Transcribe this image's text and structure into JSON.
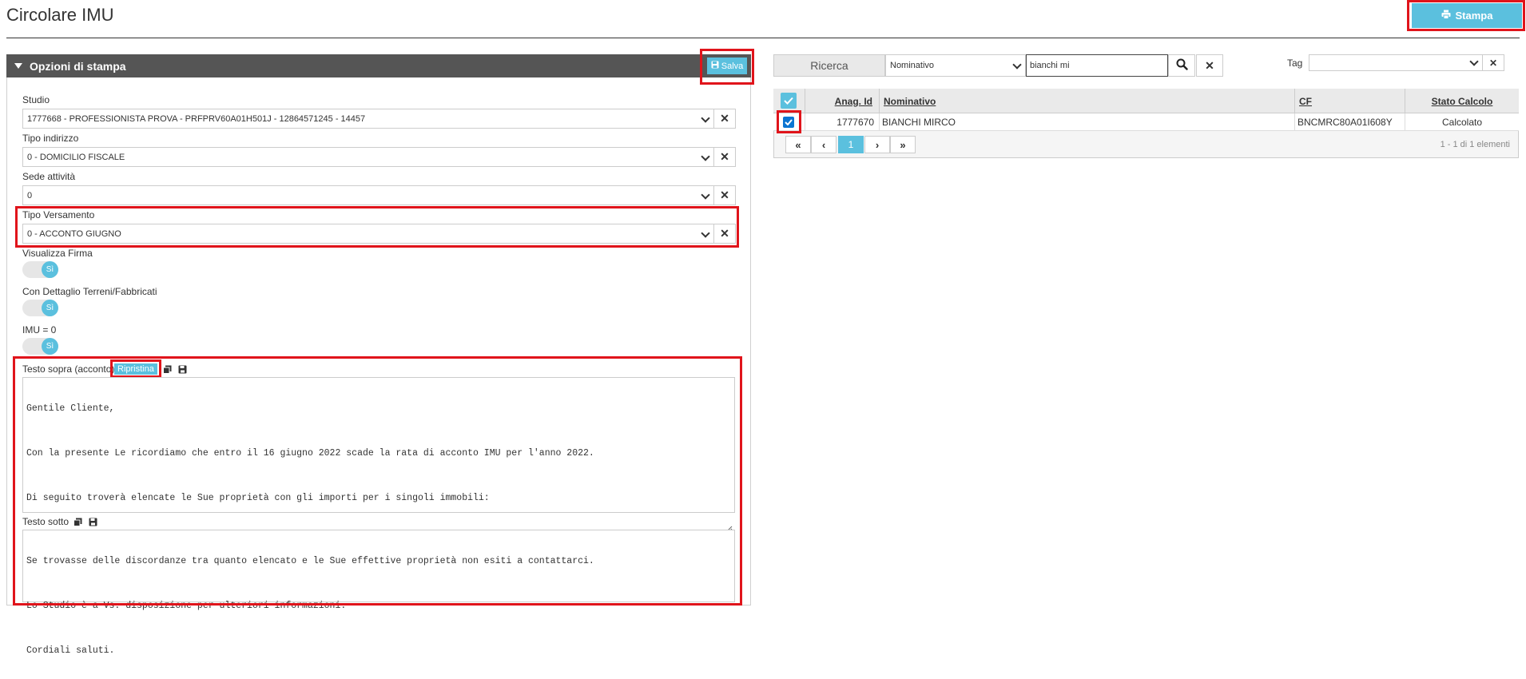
{
  "header": {
    "title": "Circolare IMU",
    "print_label": "Stampa"
  },
  "options": {
    "title": "Opzioni di stampa",
    "save_label": "Salva",
    "studio": {
      "label": "Studio",
      "value": "1777668 - PROFESSIONISTA PROVA - PRFPRV60A01H501J - 12864571245 - 14457"
    },
    "address_type": {
      "label": "Tipo indirizzo",
      "value": "0 - DOMICILIO FISCALE"
    },
    "site": {
      "label": "Sede attività",
      "value": "0"
    },
    "payment_type": {
      "label": "Tipo Versamento",
      "value": "0 - ACCONTO GIUGNO"
    },
    "show_signature": {
      "label": "Visualizza Firma",
      "value": "Sì"
    },
    "land_detail": {
      "label": "Con Dettaglio Terreni/Fabbricati",
      "value": "Sì"
    },
    "imu_zero": {
      "label": "IMU = 0",
      "value": "Sì"
    },
    "text_above": {
      "label": "Testo sopra (acconto)",
      "restore_label": "Ripristina",
      "lines": [
        "Gentile Cliente,",
        "Con la presente Le ricordiamo che entro il 16 giugno 2022 scade la rata di acconto IMU per l'anno 2022.",
        "Di seguito troverà elencate le Sue proprietà con gli importi per i singoli immobili:"
      ]
    },
    "text_below": {
      "label": "Testo sotto",
      "lines": [
        "Se trovasse delle discordanze tra quanto elencato e le Sue effettive proprietà non esiti a contattarci.",
        "Lo Studio è a Vs. disposizione per ulteriori informazioni.",
        "Cordiali saluti."
      ]
    }
  },
  "search": {
    "label": "Ricerca",
    "field_value": "Nominativo",
    "query": "bianchi mi",
    "tag_label": "Tag",
    "tag_value": ""
  },
  "grid": {
    "columns": [
      "Anag. Id",
      "Nominativo",
      "CF",
      "Stato Calcolo"
    ],
    "rows": [
      {
        "id": "1777670",
        "name": "BIANCHI MIRCO",
        "cf": "BNCMRC80A01I608Y",
        "status": "Calcolato",
        "checked": true
      }
    ],
    "pager": {
      "first": "«",
      "prev": "‹",
      "current": "1",
      "next": "›",
      "last": "»",
      "info": "1 - 1 di 1 elementi"
    }
  },
  "colors": {
    "accent": "#5bc0de",
    "panel_header": "#555555",
    "highlight": "#e0141b"
  }
}
